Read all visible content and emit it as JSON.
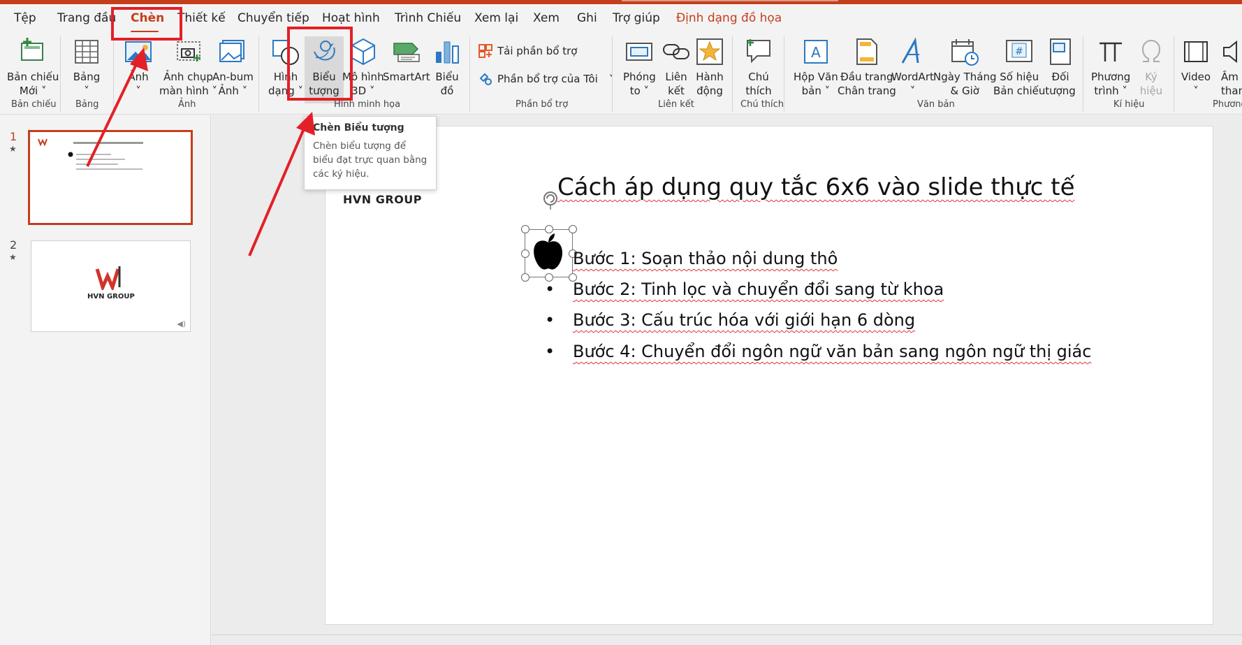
{
  "tabs": [
    {
      "label": "Tệp"
    },
    {
      "label": "Trang đầu"
    },
    {
      "label": "Chèn"
    },
    {
      "label": "Thiết kế"
    },
    {
      "label": "Chuyển tiếp"
    },
    {
      "label": "Hoạt hình"
    },
    {
      "label": "Trình Chiếu"
    },
    {
      "label": "Xem lại"
    },
    {
      "label": "Xem"
    },
    {
      "label": "Ghi"
    },
    {
      "label": "Trợ giúp"
    },
    {
      "label": "Định dạng đồ họa"
    }
  ],
  "ribbon": {
    "buttons": [
      {
        "l1": "Bản chiếu",
        "l2": "Mới ˅",
        "icon": "new-slide-icon"
      },
      {
        "l1": "Bảng",
        "l2": "˅",
        "icon": "table-icon"
      },
      {
        "l1": "Ảnh",
        "l2": "˅",
        "icon": "picture-icon"
      },
      {
        "l1": "Ảnh chụp",
        "l2": "màn hình ˅",
        "icon": "screenshot-icon"
      },
      {
        "l1": "An-bum",
        "l2": "Ảnh ˅",
        "icon": "album-icon"
      },
      {
        "l1": "Hình",
        "l2": "dạng ˅",
        "icon": "shapes-icon"
      },
      {
        "l1": "Biểu",
        "l2": "tượng",
        "icon": "icons-icon"
      },
      {
        "l1": "Mô hình",
        "l2": "3D ˅",
        "icon": "3d-model-icon"
      },
      {
        "l1": "SmartArt",
        "l2": "",
        "icon": "smartart-icon"
      },
      {
        "l1": "Biểu",
        "l2": "đồ",
        "icon": "chart-icon"
      },
      {
        "l1": "Phóng",
        "l2": "to ˅",
        "icon": "zoom-icon"
      },
      {
        "l1": "Liên",
        "l2": "kết",
        "icon": "link-icon"
      },
      {
        "l1": "Hành",
        "l2": "động",
        "icon": "action-icon"
      },
      {
        "l1": "Chú",
        "l2": "thích",
        "icon": "comment-icon"
      },
      {
        "l1": "Hộp Văn",
        "l2": "bản ˅",
        "icon": "textbox-icon"
      },
      {
        "l1": "Đầu trang",
        "l2": "Chân trang",
        "icon": "header-footer-icon"
      },
      {
        "l1": "WordArt",
        "l2": "˅",
        "icon": "wordart-icon"
      },
      {
        "l1": "Ngày Tháng",
        "l2": "& Giờ",
        "icon": "date-time-icon"
      },
      {
        "l1": "Số hiệu",
        "l2": "Bản chiếu",
        "icon": "slide-number-icon"
      },
      {
        "l1": "Đối",
        "l2": "tượng",
        "icon": "object-icon"
      },
      {
        "l1": "Phương",
        "l2": "trình ˅",
        "icon": "equation-icon"
      },
      {
        "l1": "Ký",
        "l2": "hiệu",
        "icon": "symbol-icon"
      },
      {
        "l1": "Video",
        "l2": "˅",
        "icon": "video-icon"
      },
      {
        "l1": "Âm",
        "l2": "thanh",
        "icon": "audio-icon"
      }
    ],
    "addins": {
      "get": "Tải phần bổ trợ",
      "mine": "Phần bổ trợ của Tôi"
    },
    "groups": [
      "Bản chiếu",
      "Bảng",
      "Ảnh",
      "Hình minh họa",
      "Phần bổ trợ",
      "Liên kết",
      "Chú thích",
      "Văn bản",
      "Kí hiệu",
      "Phương"
    ]
  },
  "tooltip": {
    "title": "Chèn Biểu tượng",
    "desc": "Chèn biểu tượng để biểu đạt trực quan bằng các ký hiệu."
  },
  "thumbs": [
    {
      "num": "1",
      "star": "★"
    },
    {
      "num": "2",
      "star": "★",
      "brand": "HVN GROUP"
    }
  ],
  "slide": {
    "title": "Cách áp dụng quy tắc 6x6 vào slide thực tế",
    "brand": "HVN GROUP",
    "bullets": [
      "Bước 1: Soạn thảo nội dung thô",
      "Bước 2: Tinh lọc và chuyển đổi sang từ khoa",
      "Bước 3: Cấu trúc hóa với giới hạn 6 dòng",
      "Bước 4: Chuyển đổi ngôn ngữ văn bản sang ngôn ngữ thị giác"
    ],
    "bullet_char": "•"
  },
  "colors": {
    "accent": "#c43e1c",
    "annotation": "#e32027"
  }
}
